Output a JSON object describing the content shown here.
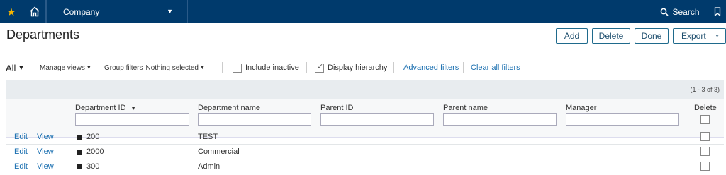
{
  "nav": {
    "company_label": "Company",
    "search_label": "Search"
  },
  "page": {
    "title": "Departments"
  },
  "toolbar": {
    "add_label": "Add",
    "delete_label": "Delete",
    "done_label": "Done",
    "export_label": "Export"
  },
  "filters": {
    "all_label": "All",
    "manage_views_label": "Manage views",
    "group_filters_label": "Group filters",
    "group_filters_value": "Nothing selected",
    "include_inactive_label": "Include inactive",
    "include_inactive_checked": false,
    "display_hierarchy_label": "Display hierarchy",
    "display_hierarchy_checked": true,
    "advanced_filters_label": "Advanced filters",
    "clear_all_filters_label": "Clear all filters"
  },
  "table": {
    "count_text": "(1 - 3 of 3)",
    "columns": {
      "department_id": "Department ID",
      "department_name": "Department name",
      "parent_id": "Parent ID",
      "parent_name": "Parent name",
      "manager": "Manager",
      "delete": "Delete"
    },
    "row_actions": {
      "edit": "Edit",
      "view": "View"
    },
    "rows": [
      {
        "id": "200",
        "name": "TEST"
      },
      {
        "id": "2000",
        "name": "Commercial"
      },
      {
        "id": "300",
        "name": "Admin"
      }
    ]
  }
}
